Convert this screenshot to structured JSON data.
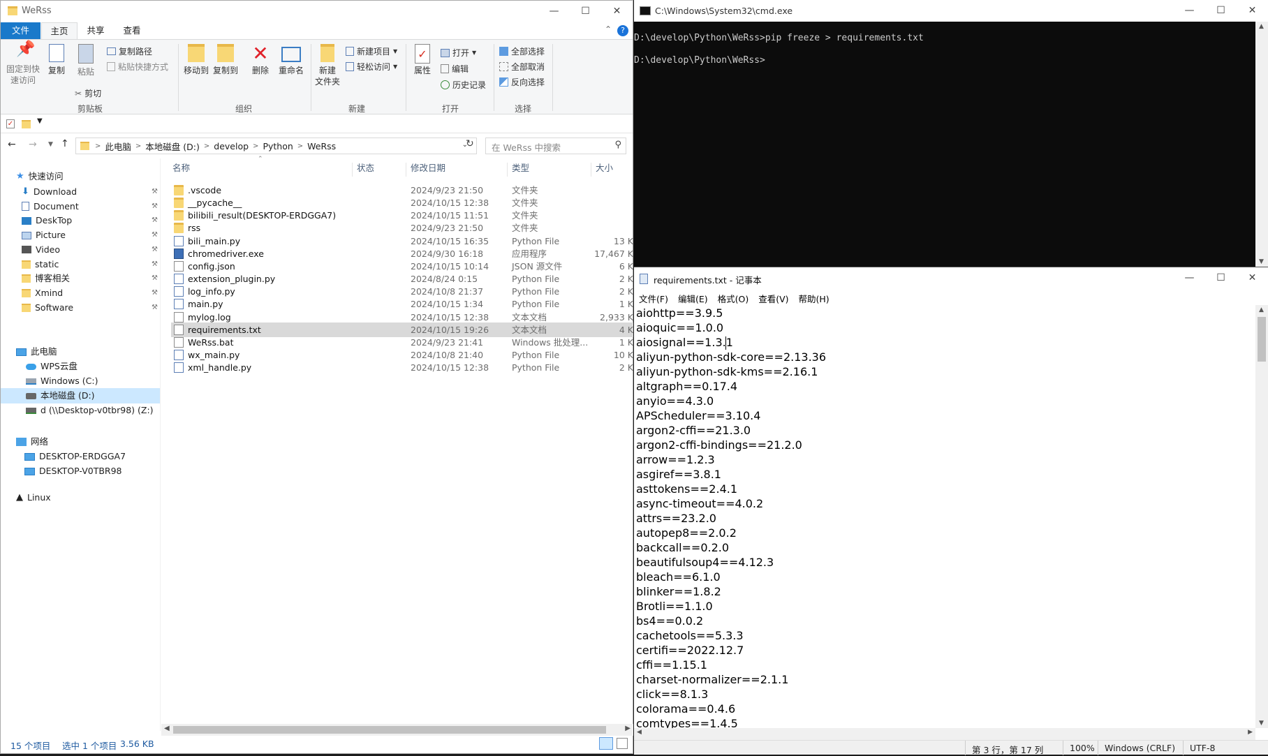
{
  "explorer": {
    "title": "WeRss",
    "tabs": [
      "文件",
      "主页",
      "共享",
      "查看"
    ],
    "ribbon": {
      "pin_label": "固定到快\n速访问",
      "copy_label": "复制",
      "paste_label": "粘贴",
      "copy_path": "复制路径",
      "paste_shortcut": "粘贴快捷方式",
      "cut": "剪切",
      "clipboard_group": "剪贴板",
      "move_to": "移动到",
      "copy_to": "复制到",
      "delete": "删除",
      "rename": "重命名",
      "organize_group": "组织",
      "new_folder": "新建\n文件夹",
      "new_item": "新建项目",
      "easy_access": "轻松访问",
      "new_group": "新建",
      "properties": "属性",
      "open": "打开",
      "edit": "编辑",
      "history": "历史记录",
      "open_group": "打开",
      "select_all": "全部选择",
      "select_none": "全部取消",
      "invert_selection": "反向选择",
      "select_group": "选择"
    },
    "address": [
      "此电脑",
      "本地磁盘 (D:)",
      "develop",
      "Python",
      "WeRss"
    ],
    "search_placeholder": "在 WeRss 中搜索",
    "nav": {
      "quick_access": "快速访问",
      "pinned": [
        "Download",
        "Document",
        "DeskTop",
        "Picture",
        "Video",
        "static",
        "博客相关",
        "Xmind",
        "Software"
      ],
      "this_pc": "此电脑",
      "pc_items": [
        "WPS云盘",
        "Windows (C:)",
        "本地磁盘 (D:)",
        "d (\\\\Desktop-v0tbr98) (Z:)"
      ],
      "network": "网络",
      "network_items": [
        "DESKTOP-ERDGGA7",
        "DESKTOP-V0TBR98"
      ],
      "linux": "Linux"
    },
    "columns": {
      "name": "名称",
      "status": "状态",
      "modified": "修改日期",
      "type": "类型",
      "size": "大小"
    },
    "files": [
      {
        "name": ".vscode",
        "date": "2024/9/23 21:50",
        "type": "文件夹",
        "size": "",
        "icon": "folder"
      },
      {
        "name": "__pycache__",
        "date": "2024/10/15 12:38",
        "type": "文件夹",
        "size": "",
        "icon": "folder"
      },
      {
        "name": "bilibili_result(DESKTOP-ERDGGA7)",
        "date": "2024/10/15 11:51",
        "type": "文件夹",
        "size": "",
        "icon": "folder"
      },
      {
        "name": "rss",
        "date": "2024/9/23 21:50",
        "type": "文件夹",
        "size": "",
        "icon": "folder"
      },
      {
        "name": "bili_main.py",
        "date": "2024/10/15 16:35",
        "type": "Python File",
        "size": "13 K",
        "icon": "py"
      },
      {
        "name": "chromedriver.exe",
        "date": "2024/9/30 16:18",
        "type": "应用程序",
        "size": "17,467 K",
        "icon": "exe"
      },
      {
        "name": "config.json",
        "date": "2024/10/15 10:14",
        "type": "JSON 源文件",
        "size": "6 K",
        "icon": "file"
      },
      {
        "name": "extension_plugin.py",
        "date": "2024/8/24 0:15",
        "type": "Python File",
        "size": "2 K",
        "icon": "py"
      },
      {
        "name": "log_info.py",
        "date": "2024/10/8 21:37",
        "type": "Python File",
        "size": "2 K",
        "icon": "py"
      },
      {
        "name": "main.py",
        "date": "2024/10/15 1:34",
        "type": "Python File",
        "size": "1 K",
        "icon": "py"
      },
      {
        "name": "mylog.log",
        "date": "2024/10/15 12:38",
        "type": "文本文档",
        "size": "2,933 K",
        "icon": "file"
      },
      {
        "name": "requirements.txt",
        "date": "2024/10/15 19:26",
        "type": "文本文档",
        "size": "4 K",
        "icon": "file",
        "selected": true
      },
      {
        "name": "WeRss.bat",
        "date": "2024/9/23 21:41",
        "type": "Windows 批处理...",
        "size": "1 K",
        "icon": "file"
      },
      {
        "name": "wx_main.py",
        "date": "2024/10/8 21:40",
        "type": "Python File",
        "size": "10 K",
        "icon": "py"
      },
      {
        "name": "xml_handle.py",
        "date": "2024/10/15 12:38",
        "type": "Python File",
        "size": "2 K",
        "icon": "py"
      }
    ],
    "status": {
      "count": "15 个项目",
      "selected": "选中 1 个项目",
      "size": "3.56 KB"
    }
  },
  "cmd": {
    "title": "C:\\Windows\\System32\\cmd.exe",
    "lines": [
      "D:\\develop\\Python\\WeRss>pip freeze > requirements.txt",
      "",
      "D:\\develop\\Python\\WeRss>"
    ]
  },
  "notepad": {
    "title": "requirements.txt - 记事本",
    "menu": [
      "文件(F)",
      "编辑(E)",
      "格式(O)",
      "查看(V)",
      "帮助(H)"
    ],
    "lines": [
      "aiohttp==3.9.5",
      "aioquic==1.0.0",
      "aiosignal==1.3.1",
      "aliyun-python-sdk-core==2.13.36",
      "aliyun-python-sdk-kms==2.16.1",
      "altgraph==0.17.4",
      "anyio==4.3.0",
      "APScheduler==3.10.4",
      "argon2-cffi==21.3.0",
      "argon2-cffi-bindings==21.2.0",
      "arrow==1.2.3",
      "asgiref==3.8.1",
      "asttokens==2.4.1",
      "async-timeout==4.0.2",
      "attrs==23.2.0",
      "autopep8==2.0.2",
      "backcall==0.2.0",
      "beautifulsoup4==4.12.3",
      "bleach==6.1.0",
      "blinker==1.8.2",
      "Brotli==1.1.0",
      "bs4==0.0.2",
      "cachetools==5.3.3",
      "certifi==2022.12.7",
      "cffi==1.15.1",
      "charset-normalizer==2.1.1",
      "click==8.1.3",
      "colorama==0.4.6",
      "comtypes==1.4.5"
    ],
    "status": {
      "position": "第 3 行，第 17 列",
      "zoom": "100%",
      "eol": "Windows (CRLF)",
      "encoding": "UTF-8"
    }
  }
}
